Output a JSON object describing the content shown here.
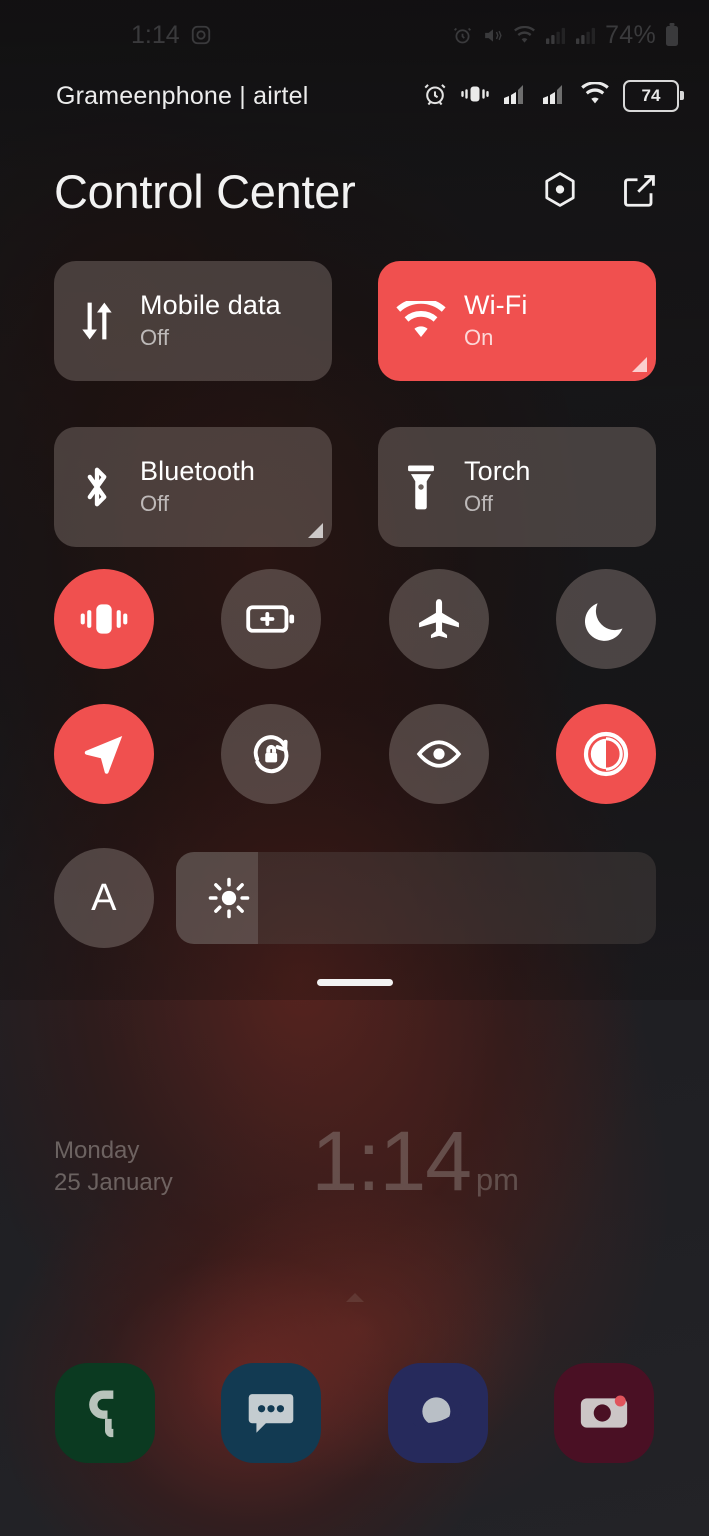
{
  "system_status_bar": {
    "time": "1:14",
    "battery_percent": "74%",
    "icons": [
      "instagram-icon",
      "alarm-icon",
      "mute-vibrate-icon",
      "wifi-icon",
      "signal-icon",
      "signal-icon",
      "battery-icon"
    ]
  },
  "panel_status_bar": {
    "carrier": "Grameenphone | airtel",
    "battery_level": "74",
    "icons": [
      "alarm-icon",
      "vibrate-icon",
      "signal-icon",
      "signal-icon",
      "wifi-icon",
      "battery-icon"
    ]
  },
  "header": {
    "title": "Control Center",
    "settings_icon": "hexagon-settings-icon",
    "edit_icon": "edit-pencil-icon"
  },
  "tiles": [
    {
      "label": "Mobile data",
      "state": "Off",
      "active": false,
      "icon": "mobile-data-arrows-icon",
      "expandable": false
    },
    {
      "label": "Wi-Fi",
      "state": "On",
      "active": true,
      "icon": "wifi-icon",
      "expandable": true
    },
    {
      "label": "Bluetooth",
      "state": "Off",
      "active": false,
      "icon": "bluetooth-icon",
      "expandable": true
    },
    {
      "label": "Torch",
      "state": "Off",
      "active": false,
      "icon": "torch-flashlight-icon",
      "expandable": false
    }
  ],
  "toggles": [
    {
      "name": "vibrate-mode",
      "icon": "vibrate-icon",
      "active": true
    },
    {
      "name": "power-saving",
      "icon": "battery-plus-icon",
      "active": false
    },
    {
      "name": "airplane-mode",
      "icon": "airplane-icon",
      "active": false
    },
    {
      "name": "dark-mode",
      "icon": "moon-icon",
      "active": false
    },
    {
      "name": "location",
      "icon": "location-arrow-icon",
      "active": true
    },
    {
      "name": "auto-rotate",
      "icon": "rotation-lock-icon",
      "active": false
    },
    {
      "name": "eye-comfort",
      "icon": "eye-icon",
      "active": false
    },
    {
      "name": "color-invert",
      "icon": "contrast-circle-icon",
      "active": true
    }
  ],
  "brightness": {
    "auto_label": "A",
    "auto_active": false,
    "slider_icon": "brightness-sun-icon",
    "fill_percent": 17
  },
  "drag_handle": "panel-drag-handle",
  "lockscreen": {
    "day": "Monday",
    "date": "25 January",
    "time": "1:14",
    "meridiem": "pm"
  },
  "dock": [
    {
      "name": "phone",
      "icon": "phone-icon",
      "bg": "#0b3a21",
      "fg": "#b9c4bc"
    },
    {
      "name": "messages",
      "icon": "messages-icon",
      "bg": "#123a52",
      "fg": "#c4ccd0"
    },
    {
      "name": "internet",
      "icon": "internet-globe-icon",
      "bg": "#262a5c",
      "fg": "#b9bfc6"
    },
    {
      "name": "camera",
      "icon": "camera-icon",
      "bg": "#4a1024",
      "fg": "#ccc6c6"
    }
  ],
  "colors": {
    "accent_red": "#f0504f",
    "tile_off": "rgba(125,113,108,0.47)",
    "background": "#232326"
  }
}
